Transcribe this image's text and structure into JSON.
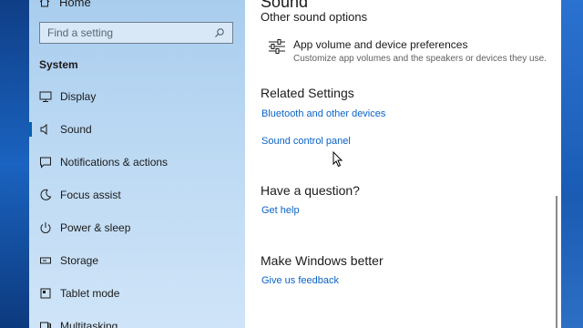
{
  "sidebar": {
    "home_label": "Home",
    "search": {
      "placeholder": "Find a setting"
    },
    "section": "System",
    "items": [
      {
        "label": "Display",
        "icon": "monitor-icon"
      },
      {
        "label": "Sound",
        "icon": "speaker-icon",
        "active": true
      },
      {
        "label": "Notifications & actions",
        "icon": "notification-icon"
      },
      {
        "label": "Focus assist",
        "icon": "moon-icon"
      },
      {
        "label": "Power & sleep",
        "icon": "power-icon"
      },
      {
        "label": "Storage",
        "icon": "storage-icon"
      },
      {
        "label": "Tablet mode",
        "icon": "tablet-icon"
      },
      {
        "label": "Multitasking",
        "icon": "multitasking-icon"
      }
    ]
  },
  "content": {
    "page_title": "Sound",
    "other_options": "Other sound options",
    "app_volume": {
      "title": "App volume and device preferences",
      "description": "Customize app volumes and the speakers or devices they use."
    },
    "related": {
      "heading": "Related Settings",
      "links": [
        "Bluetooth and other devices",
        "Sound control panel"
      ]
    },
    "question": {
      "heading": "Have a question?",
      "link": "Get help"
    },
    "better": {
      "heading": "Make Windows better",
      "link": "Give us feedback"
    }
  },
  "colors": {
    "accent": "#0063b1",
    "link": "#0a63c7",
    "sidebar": "#bcd9f3"
  }
}
